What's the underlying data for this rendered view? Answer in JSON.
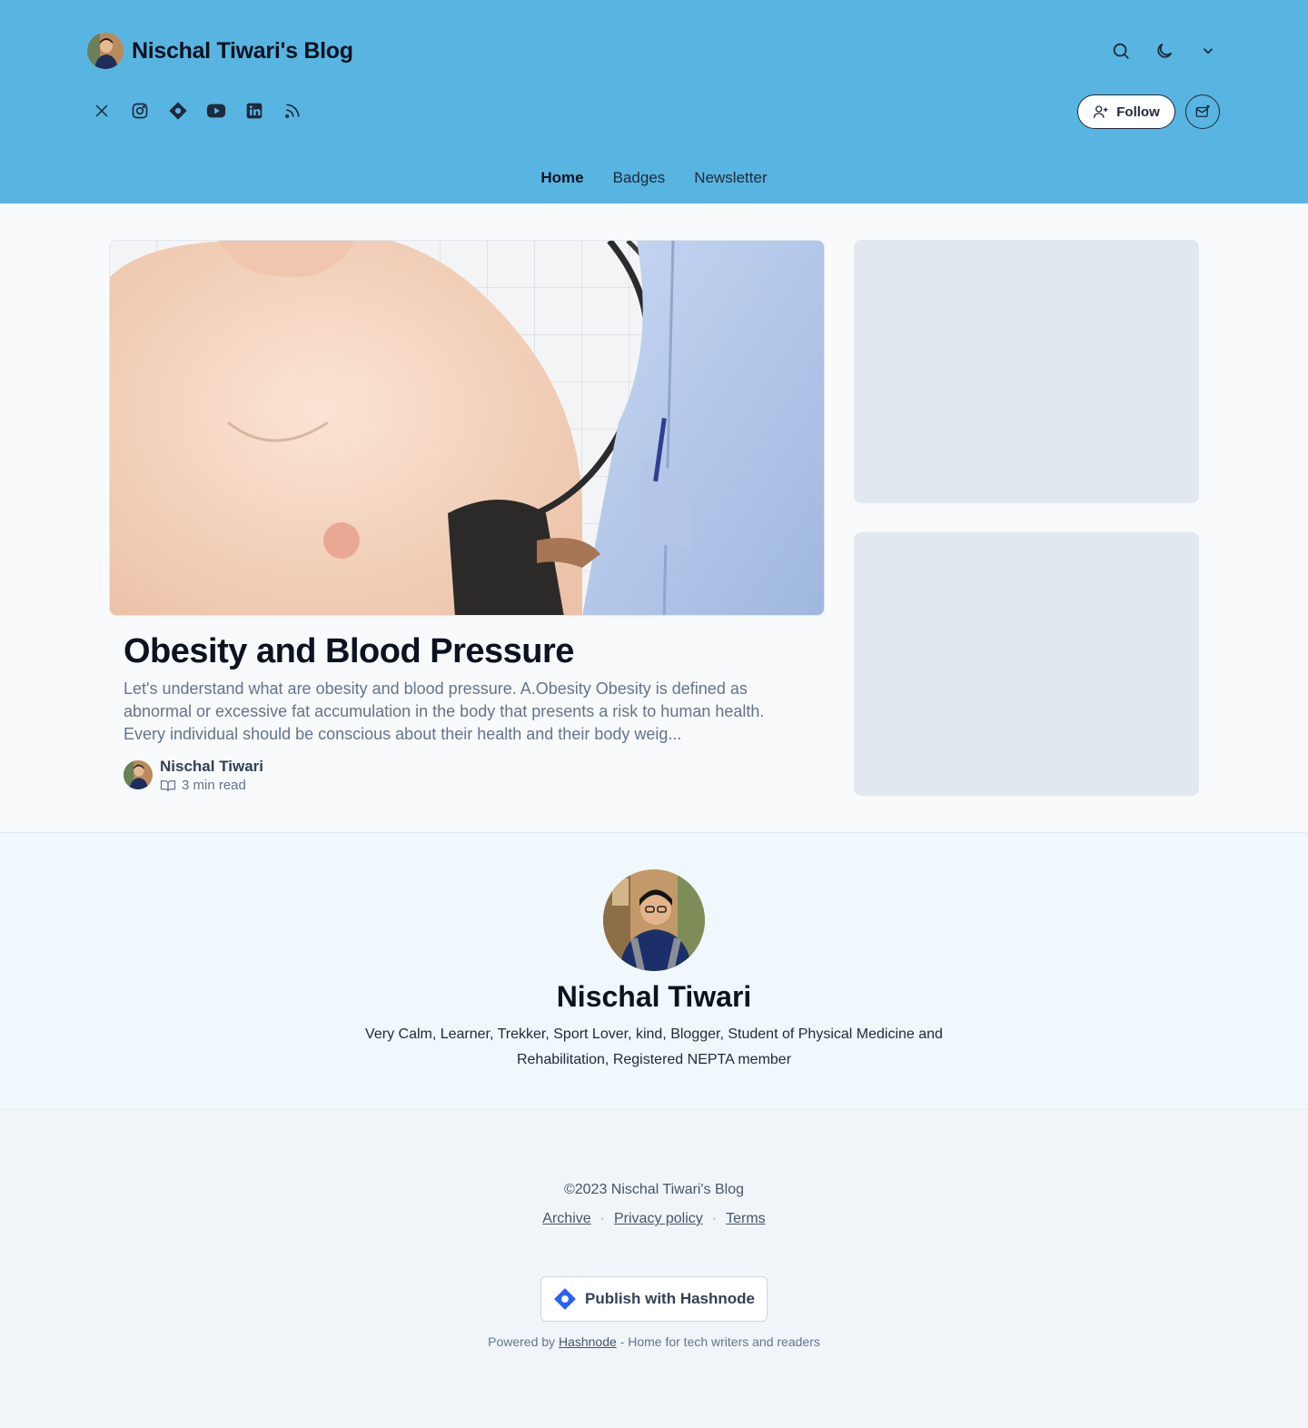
{
  "header": {
    "blog_title": "Nischal Tiwari's Blog",
    "follow_label": "Follow",
    "nav": [
      {
        "label": "Home",
        "active": true
      },
      {
        "label": "Badges",
        "active": false
      },
      {
        "label": "Newsletter",
        "active": false
      }
    ],
    "icons": [
      "search-icon",
      "moon-icon",
      "chevron-down-icon"
    ],
    "socials": [
      "x-twitter-icon",
      "instagram-icon",
      "hashnode-icon",
      "youtube-icon",
      "linkedin-icon",
      "rss-icon"
    ]
  },
  "post": {
    "title": "Obesity and Blood Pressure",
    "excerpt": "Let's understand what are obesity and blood pressure. A.Obesity Obesity is defined as abnormal or excessive fat accumulation in the body that presents a risk to human health. Every individual should be conscious about their health and their body weig...",
    "author": "Nischal Tiwari",
    "read_time": "3 min read"
  },
  "author_section": {
    "name": "Nischal Tiwari",
    "bio": "Very Calm, Learner, Trekker, Sport Lover, kind, Blogger, Student of Physical Medicine and Rehabilitation, Registered NEPTA member"
  },
  "footer": {
    "copyright": "©2023 Nischal Tiwari's Blog",
    "links": [
      "Archive",
      "Privacy policy",
      "Terms"
    ],
    "publish_label": "Publish with Hashnode",
    "powered_prefix": "Powered by",
    "powered_link": "Hashnode",
    "powered_suffix": "- Home for tech writers and readers"
  },
  "colors": {
    "header_bg": "#58b5e1",
    "hashnode_blue": "#2962ff",
    "text_dark": "#0b1220"
  }
}
